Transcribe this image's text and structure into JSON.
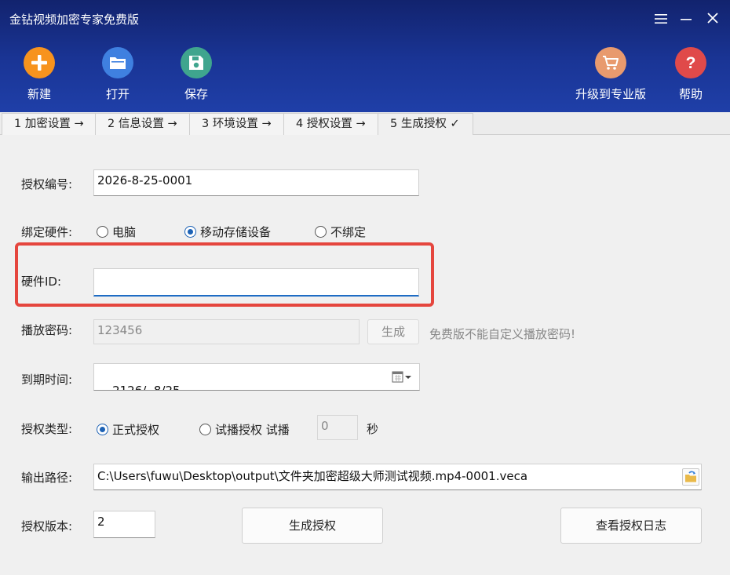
{
  "window": {
    "title": "金钻视频加密专家免费版",
    "controls": [
      "menu-icon",
      "minimize-icon",
      "close-icon"
    ]
  },
  "toolbar": {
    "new_label": "新建",
    "open_label": "打开",
    "save_label": "保存",
    "upgrade_label": "升级到专业版",
    "help_label": "帮助"
  },
  "colors": {
    "new": "#f7931e",
    "open": "#3f80e0",
    "save": "#3fa58e",
    "upgrade": "#e89a6e",
    "help": "#e04a4a",
    "highlight": "#e5463e"
  },
  "tabs": [
    {
      "label": "1 加密设置 →"
    },
    {
      "label": "2 信息设置 →"
    },
    {
      "label": "3 环境设置 →"
    },
    {
      "label": "4 授权设置 →"
    },
    {
      "label": "5 生成授权 ✓",
      "active": true
    }
  ],
  "form": {
    "license_no": {
      "label": "授权编号:",
      "value": "2026-8-25-0001"
    },
    "bind_hardware": {
      "label": "绑定硬件:",
      "options": [
        "电脑",
        "移动存储设备",
        "不绑定"
      ],
      "selected": "移动存储设备"
    },
    "hardware_id": {
      "label": "硬件ID:",
      "value": ""
    },
    "play_password": {
      "label": "播放密码:",
      "value": "123456",
      "button": "生成",
      "note": "免费版不能自定义播放密码!"
    },
    "expire": {
      "label": "到期时间:",
      "value": "2126/  8/25"
    },
    "license_type": {
      "label": "授权类型:",
      "options": [
        "正式授权",
        "试播授权 试播"
      ],
      "selected": "正式授权",
      "trial_seconds": "0",
      "seconds_unit": "秒"
    },
    "output_path": {
      "label": "输出路径:",
      "value": "C:\\Users\\fuwu\\Desktop\\output\\文件夹加密超级大师测试视频.mp4-0001.veca"
    },
    "version": {
      "label": "授权版本:",
      "value": "2"
    }
  },
  "actions": {
    "generate_label": "生成授权",
    "log_label": "查看授权日志"
  }
}
